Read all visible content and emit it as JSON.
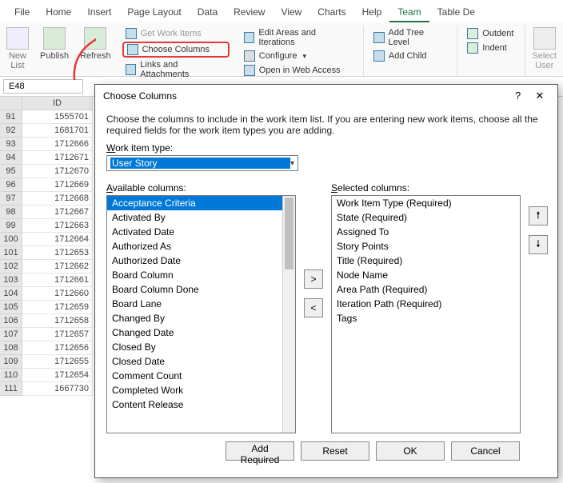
{
  "tabs": [
    "File",
    "Home",
    "Insert",
    "Page Layout",
    "Data",
    "Review",
    "View",
    "Charts",
    "Help",
    "Team",
    "Table De"
  ],
  "active_tab": "Team",
  "ribbon": {
    "new_list": "New\nList",
    "publish": "Publish",
    "refresh": "Refresh",
    "get_work": "Get Work Items",
    "choose_cols": "Choose Columns",
    "links": "Links and Attachments",
    "edit_areas": "Edit Areas and Iterations",
    "configure": "Configure",
    "open_web": "Open in Web Access",
    "add_tree": "Add Tree Level",
    "add_child": "Add Child",
    "outdent": "Outdent",
    "indent": "Indent",
    "select_user": "Select\nUser"
  },
  "name_box": "E48",
  "col_header": "ID",
  "row_start": 91,
  "ids": [
    1555701,
    1681701,
    1712666,
    1712671,
    1712670,
    1712669,
    1712668,
    1712667,
    1712663,
    1712664,
    1712653,
    1712662,
    1712661,
    1712660,
    1712659,
    1712658,
    1712657,
    1712656,
    1712655,
    1712654,
    1667730
  ],
  "dialog": {
    "title": "Choose Columns",
    "hint": "Choose the columns to include in the work item list.  If you are entering new work items, choose all the required fields for the work item types you are adding.",
    "wit_lbl": "Work item type:",
    "wit_val": "User Story",
    "avail_lbl": "Available columns:",
    "sel_lbl": "Selected columns:",
    "available": [
      "Acceptance Criteria",
      "Activated By",
      "Activated Date",
      "Authorized As",
      "Authorized Date",
      "Board Column",
      "Board Column Done",
      "Board Lane",
      "Changed By",
      "Changed Date",
      "Closed By",
      "Closed Date",
      "Comment Count",
      "Completed Work",
      "Content Release"
    ],
    "selected": [
      "Work Item Type (Required)",
      "State (Required)",
      "Assigned To",
      "Story Points",
      "Title (Required)",
      "Node Name",
      "Area Path (Required)",
      "Iteration Path (Required)",
      "Tags"
    ],
    "btn_add": "Add Required",
    "btn_reset": "Reset",
    "btn_ok": "OK",
    "btn_cancel": "Cancel"
  }
}
